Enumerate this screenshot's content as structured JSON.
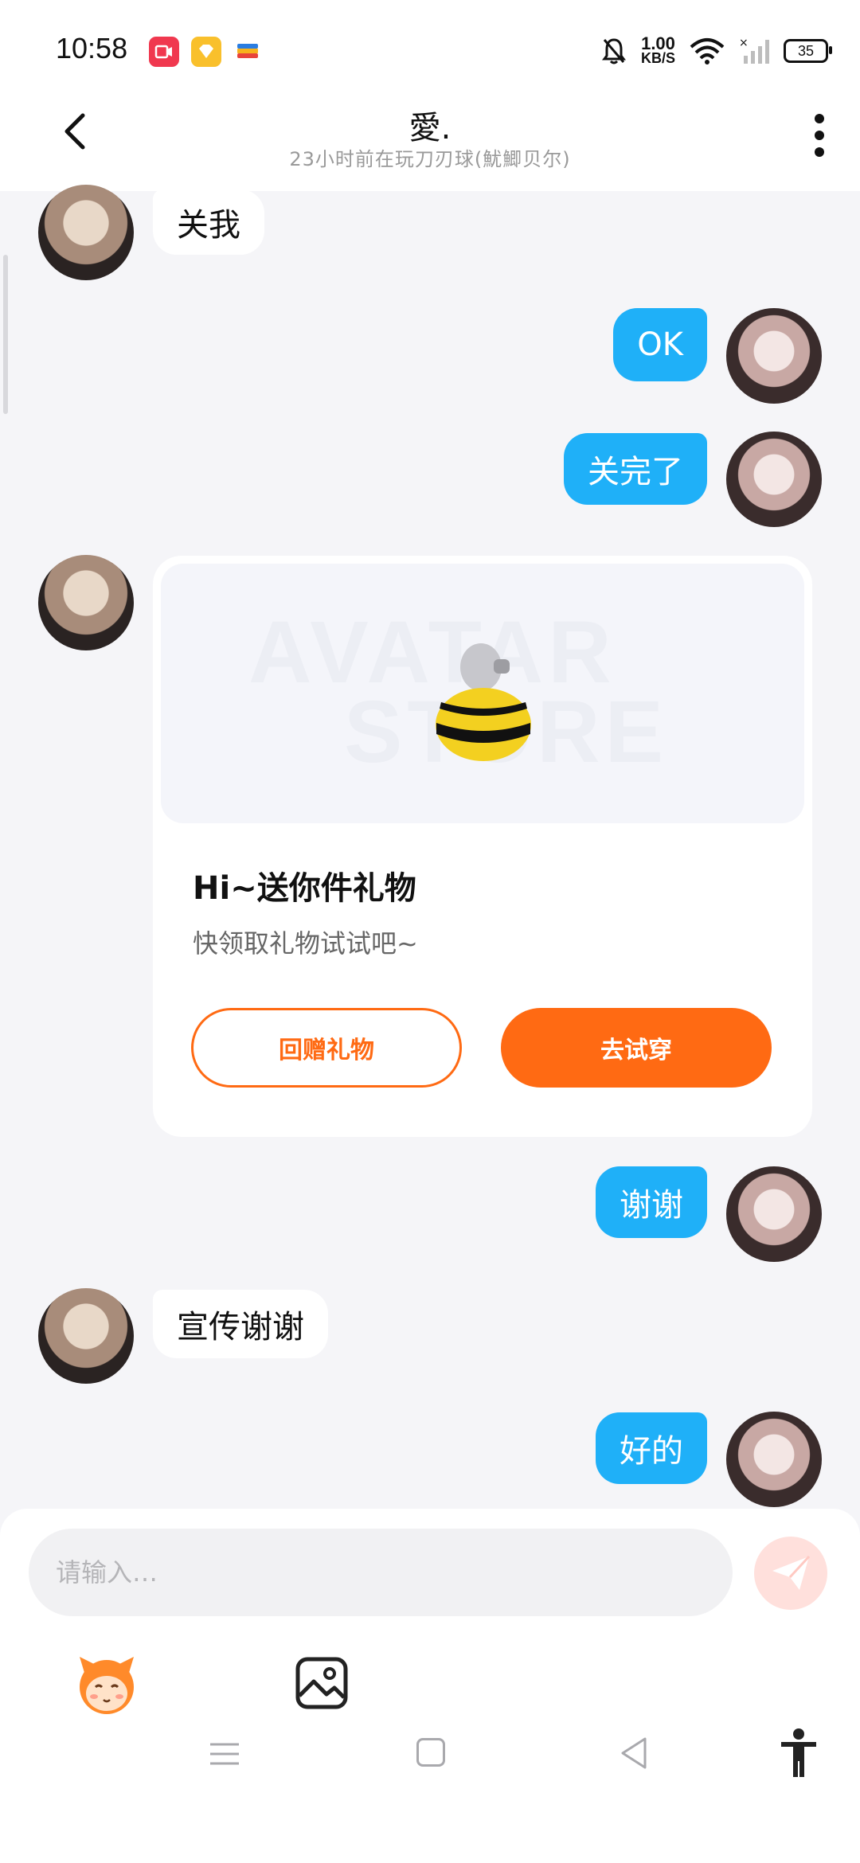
{
  "status_bar": {
    "time": "10:58",
    "net_speed": "1.00",
    "net_unit": "KB/S",
    "battery": "35",
    "app_icons": [
      "screen-record-icon",
      "diamond-app-icon",
      "wallet-app-icon"
    ],
    "colors": {
      "record": "#f0384f",
      "diamond": "#f9c02c"
    }
  },
  "header": {
    "title": "愛.",
    "subtitle": "23小时前在玩刀刃球(魷鯽贝尔)"
  },
  "messages": [
    {
      "side": "left",
      "text": "关我"
    },
    {
      "side": "right",
      "text": "OK"
    },
    {
      "side": "right",
      "text": "关完了"
    },
    {
      "side": "left",
      "type": "gift_card"
    },
    {
      "side": "right",
      "text": "谢谢"
    },
    {
      "side": "left",
      "text": "宣传谢谢"
    },
    {
      "side": "right",
      "text": "好的"
    }
  ],
  "gift_card": {
    "watermark_1": "AVATAR",
    "watermark_2": "STORE",
    "title": "Hi~送你件礼物",
    "subtitle": "快领取礼物试试吧~",
    "return_gift_button": "回赠礼物",
    "try_on_button": "去试穿",
    "accent_color": "#ff6a13"
  },
  "composer": {
    "placeholder": "请输入…",
    "value": ""
  },
  "theme": {
    "bubble_right": "#1fb0f8",
    "background": "#f5f5f8"
  }
}
